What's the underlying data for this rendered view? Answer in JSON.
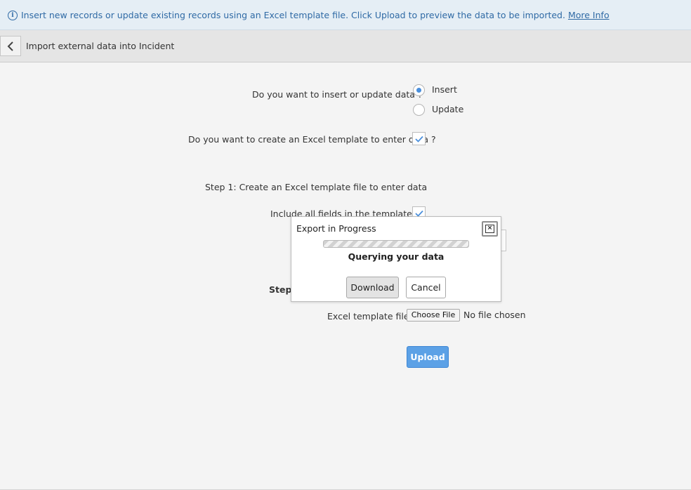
{
  "info_bar": {
    "icon": "info-icon",
    "message": "Insert new records or update existing records using an Excel template file. Click Upload to preview the data to be imported.",
    "link": "More Info"
  },
  "header": {
    "back_icon": "chevron-left-icon",
    "title": "Import external data into Incident"
  },
  "form": {
    "mode_question": "Do you want to insert or update data ?",
    "mode_options": [
      {
        "label": "Insert",
        "selected": true
      },
      {
        "label": "Update",
        "selected": false
      }
    ],
    "template_question": "Do you want to create an Excel template to enter data ?",
    "template_checked": true,
    "step1_heading": "Step  1:  Create an Excel template file to enter data",
    "include_all_label": "Include all fields in the template?",
    "include_all_checked": true,
    "step2_partial": "Step",
    "file_label": "Excel template file",
    "choose_file": "Choose File",
    "no_file": "No file chosen",
    "upload": "Upload"
  },
  "dialog": {
    "title": "Export in Progress",
    "close_icon": "close-icon",
    "status": "Querying your data",
    "download": "Download",
    "cancel": "Cancel"
  },
  "colors": {
    "accent": "#5ca1e6",
    "info_text": "#2f6aa5",
    "info_bg": "#e5eef5"
  }
}
